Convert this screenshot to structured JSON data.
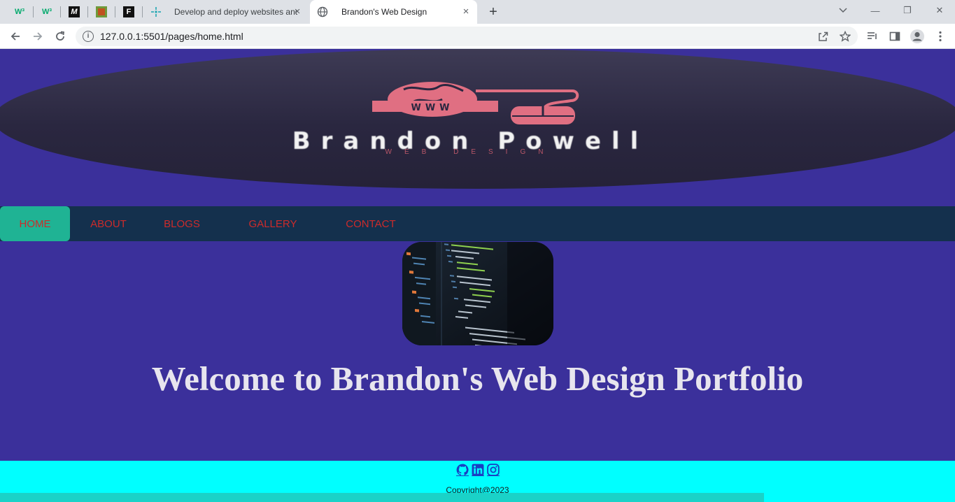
{
  "browser": {
    "pinned_tabs": [
      {
        "icon": "w3schools-icon",
        "glyph": "W³",
        "color": "#04aa6d"
      },
      {
        "icon": "w3schools-icon",
        "glyph": "W³",
        "color": "#04aa6d"
      },
      {
        "icon": "medium-icon",
        "glyph": "M",
        "color": "#000000"
      },
      {
        "icon": "square-app-icon",
        "glyph": "",
        "color": "#8a6d1f"
      },
      {
        "icon": "figma-file-icon",
        "glyph": "F",
        "color": "#000000"
      }
    ],
    "tabs": [
      {
        "title": "Develop and deploy websites and",
        "icon": "netlify-icon",
        "close": "×"
      },
      {
        "title": "Brandon's Web Design",
        "icon": "globe-icon",
        "close": "×"
      }
    ],
    "new_tab": "+",
    "url": "127.0.0.1:5501/pages/home.html",
    "window_controls": {
      "minimize": "—",
      "restore": "❐",
      "close": "✕"
    }
  },
  "header": {
    "logo_name": "Brandon Powell",
    "logo_tagline": "WEB DESIGN",
    "logo_www": "WWW"
  },
  "nav": {
    "items": [
      {
        "label": "HOME",
        "active": true
      },
      {
        "label": "ABOUT",
        "active": false
      },
      {
        "label": "BLOGS",
        "active": false
      },
      {
        "label": "GALLERY",
        "active": false
      },
      {
        "label": "CONTACT",
        "active": false
      }
    ]
  },
  "main": {
    "heading": "Welcome to Brandon's Web Design Portfolio"
  },
  "footer": {
    "social_icons": [
      "github-icon",
      "linkedin-icon",
      "instagram-icon"
    ],
    "copyright": "Copyright@2023"
  },
  "colors": {
    "page_bg": "#3b309b",
    "nav_bg": "#14304d",
    "nav_active": "#1fb394",
    "nav_text": "#cc2b2b",
    "footer_bg": "#00ffff",
    "logo_pink": "#e06f82"
  }
}
